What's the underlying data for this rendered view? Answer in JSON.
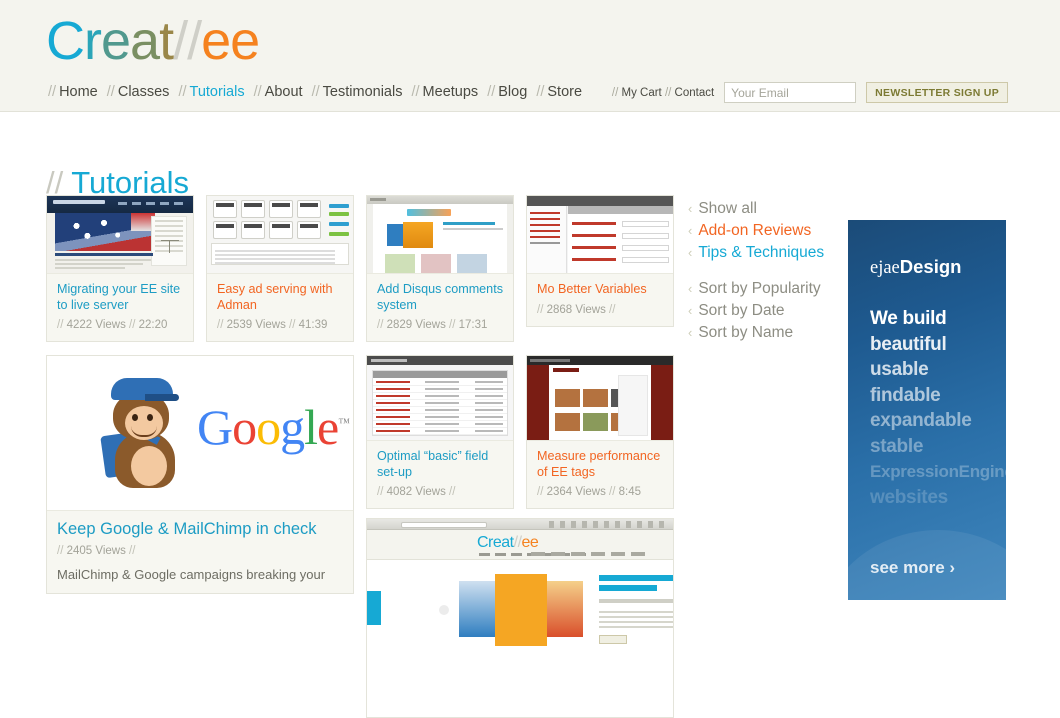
{
  "header": {
    "logo": {
      "part1": "Creat",
      "slashes": "//",
      "part2": "ee"
    },
    "nav": [
      {
        "label": "Home",
        "active": false
      },
      {
        "label": "Classes",
        "active": false
      },
      {
        "label": "Tutorials",
        "active": true
      },
      {
        "label": "About",
        "active": false
      },
      {
        "label": "Testimonials",
        "active": false
      },
      {
        "label": "Meetups",
        "active": false
      },
      {
        "label": "Blog",
        "active": false
      },
      {
        "label": "Store",
        "active": false
      }
    ],
    "util_links": [
      {
        "label": "My Cart"
      },
      {
        "label": "Contact"
      }
    ],
    "email_placeholder": "Your Email",
    "email_value": "",
    "newsletter_button": "NEWSLETTER SIGN UP",
    "separator": "//"
  },
  "page": {
    "title": "Tutorials",
    "title_prefix": "//"
  },
  "cards": [
    {
      "title": "Migrating your EE site to live server",
      "views": "4222 Views",
      "duration": "22:20",
      "category": "tips",
      "color": "#1d9cc4",
      "thumb": "law-firm-site-screenshot"
    },
    {
      "title": "Easy ad serving with Adman",
      "views": "2539 Views",
      "duration": "41:39",
      "category": "addon",
      "color": "#f26522",
      "thumb": "adman-dashboard-screenshot"
    },
    {
      "title": "Add Disqus comments system",
      "views": "2829 Views",
      "duration": "17:31",
      "category": "tips",
      "color": "#1d9cc4",
      "thumb": "blog-comments-screenshot"
    },
    {
      "title": "Mo Better Variables",
      "views": "2868 Views",
      "duration": "",
      "category": "addon",
      "color": "#f26522",
      "thumb": "ee-control-panel-screenshot"
    },
    {
      "title": "Keep Google & MailChimp in check",
      "views": "2405 Views",
      "duration": "",
      "category": "tips",
      "color": "#1d9cc4",
      "description": "MailChimp & Google campaigns breaking your",
      "thumb": "mailchimp-monkey-google-logo"
    },
    {
      "title": "Optimal “basic” field set-up",
      "views": "4082 Views",
      "duration": "",
      "category": "tips",
      "color": "#1d9cc4",
      "thumb": "field-setup-table-screenshot"
    },
    {
      "title": "Measure performance of EE tags",
      "views": "2364 Views",
      "duration": "8:45",
      "category": "addon",
      "color": "#f26522",
      "thumb": "ee-tags-performance-screenshot"
    },
    {
      "title": "",
      "views": "",
      "duration": "",
      "category": "tips",
      "color": "#1d9cc4",
      "thumb": "creatree-site-screenshot"
    }
  ],
  "sidebar": {
    "filters": [
      {
        "label": "Show all",
        "style": "gray"
      },
      {
        "label": "Add-on Reviews",
        "style": "orange"
      },
      {
        "label": "Tips & Techniques",
        "style": "cyan"
      }
    ],
    "sorts": [
      {
        "label": "Sort by Popularity"
      },
      {
        "label": "Sort by Date"
      },
      {
        "label": "Sort by Name"
      }
    ],
    "chevron": "‹"
  },
  "ad": {
    "logo_light": "ejae",
    "logo_bold": "Design",
    "lines": [
      {
        "text": "We build",
        "opacity": 1.0
      },
      {
        "text": "beautiful",
        "opacity": 0.9
      },
      {
        "text": "usable",
        "opacity": 0.78
      },
      {
        "text": "findable",
        "opacity": 0.64
      },
      {
        "text": "expandable",
        "opacity": 0.5
      },
      {
        "text": "stable",
        "opacity": 0.38
      },
      {
        "text": "ExpressionEngine",
        "opacity": 0.28
      },
      {
        "text": "websites",
        "opacity": 0.2
      }
    ],
    "cta": "see more ›"
  },
  "thumb_text": {
    "self_logo_a": "Creat",
    "self_logo_s": "//",
    "self_logo_c": "ee",
    "google_letters": [
      "G",
      "o",
      "o",
      "g",
      "l",
      "e"
    ]
  }
}
